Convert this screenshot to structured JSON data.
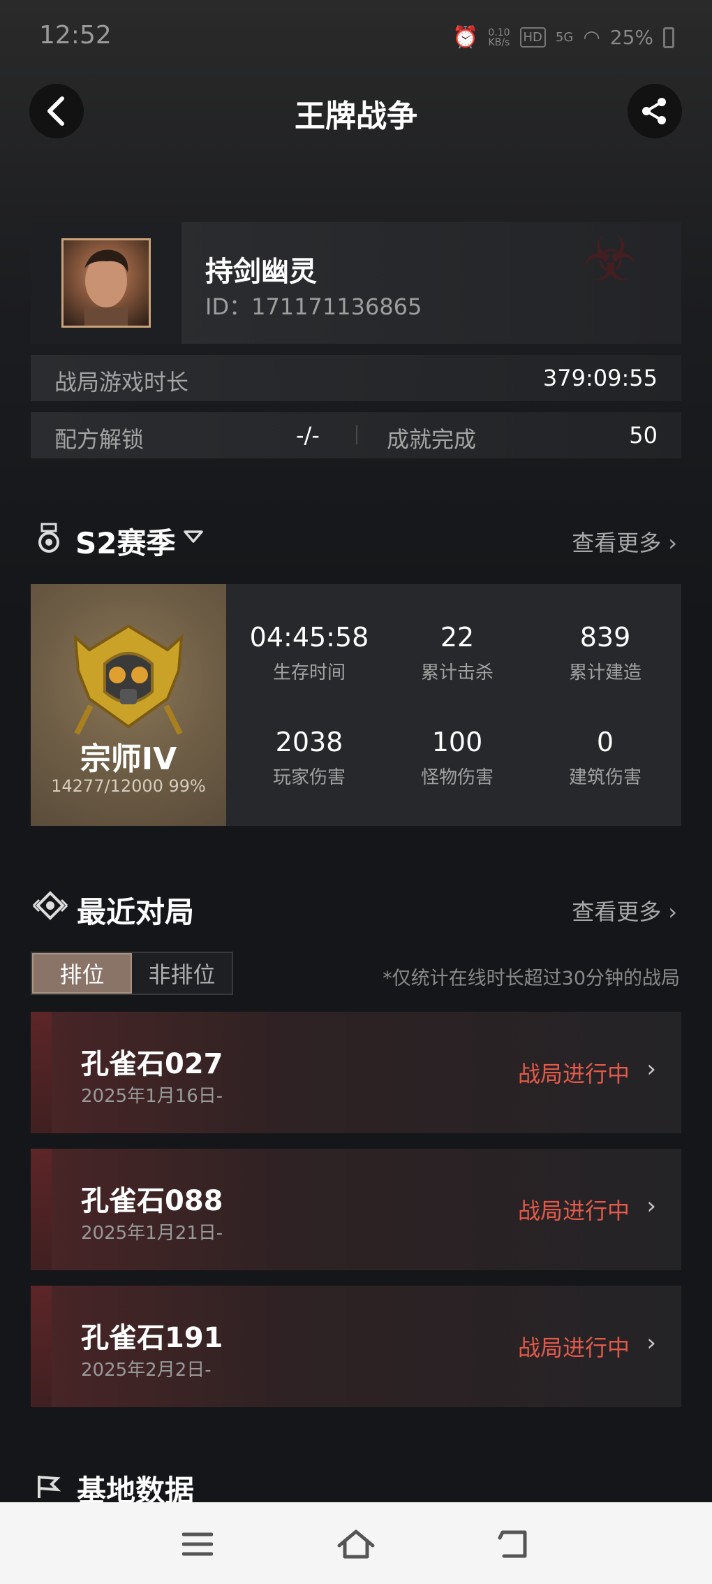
{
  "status_bar": {
    "time": "12:52",
    "net_speed_top": "0.10",
    "net_speed_bottom": "KB/s",
    "hd": "HD",
    "signal": "5G",
    "battery": "25%"
  },
  "header": {
    "title": "王牌战争"
  },
  "profile": {
    "name": "持剑幽灵",
    "id_text": "ID：171171136865",
    "duration_label": "战局游戏时长",
    "duration_value": "379:09:55",
    "recipe_label": "配方解锁",
    "recipe_value": "-/-",
    "achievement_label": "成就完成",
    "achievement_value": "50"
  },
  "season": {
    "title": "S2赛季",
    "see_more": "查看更多",
    "rank_name": "宗师IV",
    "rank_progress": "14277/12000 99%",
    "stats": [
      {
        "value": "04:45:58",
        "label": "生存时间"
      },
      {
        "value": "22",
        "label": "累计击杀"
      },
      {
        "value": "839",
        "label": "累计建造"
      },
      {
        "value": "2038",
        "label": "玩家伤害"
      },
      {
        "value": "100",
        "label": "怪物伤害"
      },
      {
        "value": "0",
        "label": "建筑伤害"
      }
    ]
  },
  "recent": {
    "title": "最近对局",
    "see_more": "查看更多",
    "tabs": [
      "排位",
      "非排位"
    ],
    "note": "*仅统计在线时长超过30分钟的战局",
    "games": [
      {
        "name": "孔雀石027",
        "date": "2025年1月16日-",
        "status": "战局进行中"
      },
      {
        "name": "孔雀石088",
        "date": "2025年1月21日-",
        "status": "战局进行中"
      },
      {
        "name": "孔雀石191",
        "date": "2025年2月2日-",
        "status": "战局进行中"
      }
    ]
  },
  "base": {
    "title": "基地数据"
  },
  "colors": {
    "accent_red": "#e35a4a",
    "rank_gold": "#c9a227"
  }
}
